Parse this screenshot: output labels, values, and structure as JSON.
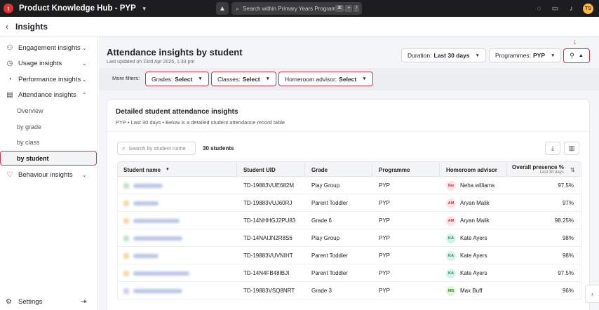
{
  "topbar": {
    "logo_letter": "t",
    "app_title": "Product Knowledge Hub - PYP",
    "search_placeholder": "Search within Primary Years Programme...",
    "shortcut_keys": [
      "⌘",
      "+",
      "/"
    ],
    "avatar_initials": "TS"
  },
  "page": {
    "title": "Insights"
  },
  "sidebar": {
    "items": [
      {
        "label": "Engagement insights",
        "icon": "engagement-icon"
      },
      {
        "label": "Usage insights",
        "icon": "usage-icon"
      },
      {
        "label": "Performance insights",
        "icon": "performance-icon"
      },
      {
        "label": "Attendance insights",
        "icon": "attendance-icon"
      }
    ],
    "attendance_sub": [
      "Overview",
      "by grade",
      "by class",
      "by student"
    ],
    "behaviour": "Behaviour insights",
    "settings": "Settings"
  },
  "main": {
    "title": "Attendance insights by student",
    "updated": "Last updated on 23rd Apr 2025, 1:33 pm",
    "duration_label": "Duration:",
    "duration_value": "Last 30 days",
    "programmes_label": "Programmes:",
    "programmes_value": "PYP",
    "more_filters": "More filters:",
    "filters": [
      {
        "label": "Grades:",
        "value": "Select"
      },
      {
        "label": "Classes:",
        "value": "Select"
      },
      {
        "label": "Homeroom advisor:",
        "value": "Select"
      }
    ]
  },
  "card": {
    "title": "Detailed student attendance insights",
    "subtitle": "PYP  •  Last 30 days  •  Below is a detailed student attendance record table",
    "search_placeholder": "Search by student name",
    "count": "30 students"
  },
  "table": {
    "headers": {
      "name": "Student name",
      "uid": "Student UID",
      "grade": "Grade",
      "programme": "Programme",
      "advisor": "Homeroom advisor",
      "presence": "Overall presence %",
      "presence_sub": "Last 30 days"
    },
    "rows": [
      {
        "uid": "TD-19883VUE682M",
        "grade": "Play Group",
        "programme": "PYP",
        "adv_initials": "Nw",
        "advisor": "Neha williams",
        "presence": "97.5%",
        "adv_bg": "#fde3e7",
        "adv_fg": "#c2334b",
        "dot": "#bfe3c8",
        "w": 42
      },
      {
        "uid": "TD-19883VUJ60RJ",
        "grade": "Parent Toddler",
        "programme": "PYP",
        "adv_initials": "AM",
        "advisor": "Aryan Malik",
        "presence": "97%",
        "adv_bg": "#fde3e7",
        "adv_fg": "#c2334b",
        "dot": "#f6d9a8",
        "w": 36
      },
      {
        "uid": "TD-14NHHGJ2PU83",
        "grade": "Grade 6",
        "programme": "PYP",
        "adv_initials": "AM",
        "advisor": "Aryan Malik",
        "presence": "98.25%",
        "adv_bg": "#fde3e7",
        "adv_fg": "#c2334b",
        "dot": "#f6d9a8",
        "w": 66
      },
      {
        "uid": "TD-14NAIJN2R8S6",
        "grade": "Play Group",
        "programme": "PYP",
        "adv_initials": "KA",
        "advisor": "Kate Ayers",
        "presence": "98%",
        "adv_bg": "#d6f3ea",
        "adv_fg": "#1c8a68",
        "dot": "#bfe3c8",
        "w": 70
      },
      {
        "uid": "TD-19883VUVNIHT",
        "grade": "Parent Toddler",
        "programme": "PYP",
        "adv_initials": "KA",
        "advisor": "Kate Ayers",
        "presence": "98%",
        "adv_bg": "#d6f3ea",
        "adv_fg": "#1c8a68",
        "dot": "#f6d9a8",
        "w": 36
      },
      {
        "uid": "TD-14N4FB48IBJI",
        "grade": "Parent Toddler",
        "programme": "PYP",
        "adv_initials": "KA",
        "advisor": "Kate Ayers",
        "presence": "97.5%",
        "adv_bg": "#d6f3ea",
        "adv_fg": "#1c8a68",
        "dot": "#f6d9a8",
        "w": 80
      },
      {
        "uid": "TD-19883VSQ8NRT",
        "grade": "Grade 3",
        "programme": "PYP",
        "adv_initials": "MB",
        "advisor": "Max Buff",
        "presence": "96%",
        "adv_bg": "#dff4d9",
        "adv_fg": "#3f8f2a",
        "dot": "#d8c9ee",
        "w": 70
      }
    ]
  }
}
